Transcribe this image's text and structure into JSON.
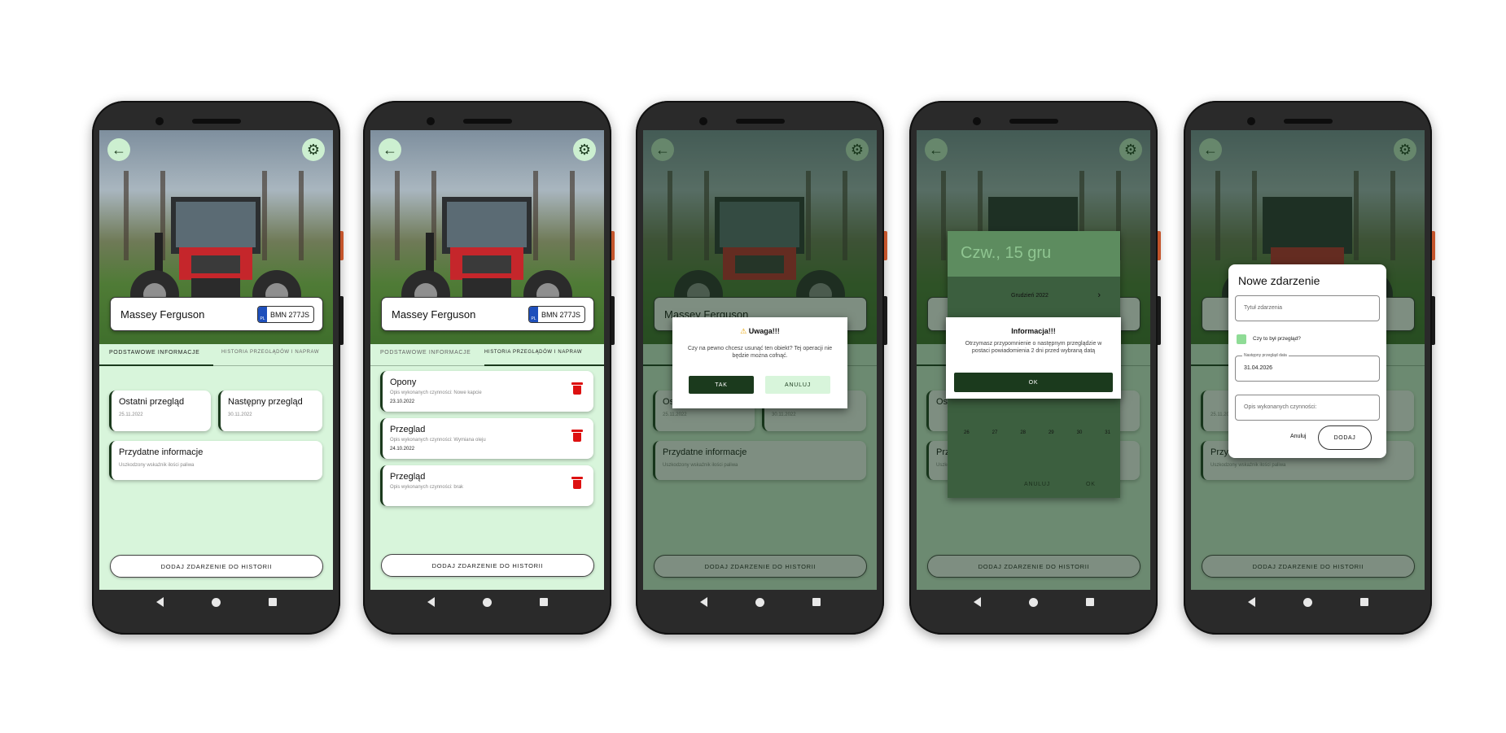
{
  "vehicle": {
    "name": "Massey Ferguson",
    "plate": "BMN 277JS",
    "plate_country": "PL"
  },
  "tabs": {
    "basic": "Podstawowe informacje",
    "history": "Historia przeglądów i napraw"
  },
  "info_cards": {
    "last_review_title": "Ostatni przegląd",
    "last_review_date": "25.11.2022",
    "next_review_title": "Następny przegląd",
    "next_review_date": "30.11.2022",
    "useful_title": "Przydatne informacje",
    "useful_text": "Uszkodzony wskaźnik ilości paliwa"
  },
  "history": [
    {
      "title": "Opony",
      "desc": "Opis wykonanych czynności: Nowe kapcie",
      "date": "23.10.2022"
    },
    {
      "title": "Przeglad",
      "desc": "Opis wykonanych czynności: Wymiana oleju",
      "date": "24.10.2022"
    },
    {
      "title": "Przegląd",
      "desc": "Opis wykonanych czynności: brak",
      "date": ""
    }
  ],
  "add_event_button": "Dodaj zdarzenie do historii",
  "delete_dialog": {
    "title": "Uwaga!!!",
    "message": "Czy na pewno chcesz usunąć ten obiekt? Tej operacji nie będzie można cofnąć.",
    "confirm": "Tak",
    "cancel": "Anuluj"
  },
  "calendar": {
    "header_date": "Czw., 15 gru",
    "month": "Grudzień 2022",
    "last_row": [
      "26",
      "27",
      "28",
      "29",
      "30",
      "31"
    ],
    "cancel": "Anuluj",
    "ok": "OK"
  },
  "info_dialog": {
    "title": "Informacja!!!",
    "message": "Otrzymasz przypomnienie o następnym przeglądzie w postaci powiadomienia 2 dni przed wybraną datą",
    "ok": "OK"
  },
  "new_event_dialog": {
    "title": "Nowe zdarzenie",
    "title_placeholder": "Tytuł zdarzenia",
    "checkbox_label": "Czy to był przegląd?",
    "next_review_label": "Następny przegląd data",
    "next_review_value": "31.04.2026",
    "description_placeholder": "Opis wykonanych czynności:",
    "cancel": "Anuluj",
    "add": "Dodaj"
  },
  "colors": {
    "dark_green": "#1b3a1d",
    "light_green": "#d8f5db",
    "delete_red": "#dd1111"
  },
  "icons": {
    "back": "arrow-left-icon",
    "settings": "gear-icon",
    "delete": "trash-icon",
    "warning": "warning-icon"
  }
}
